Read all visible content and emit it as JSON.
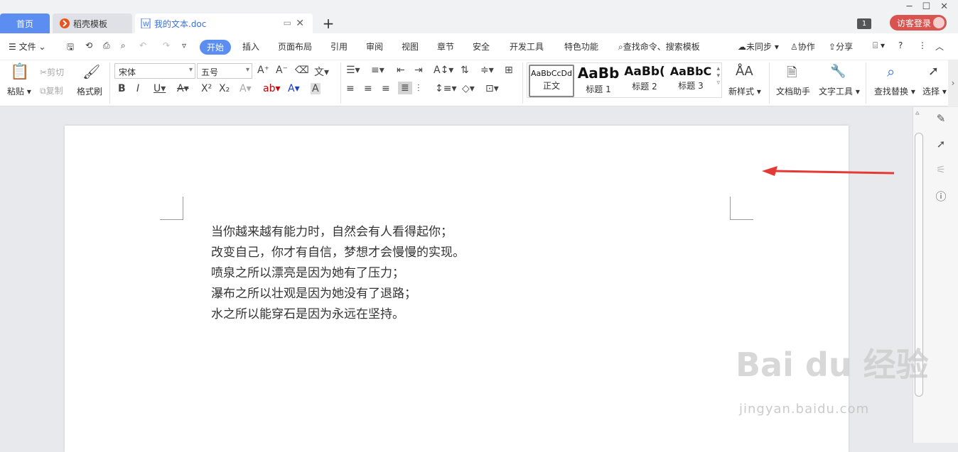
{
  "tabs": {
    "home": "首页",
    "template": "稻壳模板",
    "doc": "我的文本.doc"
  },
  "header": {
    "badge": "1",
    "login": "访客登录"
  },
  "menu": {
    "file": "文件",
    "items": [
      "开始",
      "插入",
      "页面布局",
      "引用",
      "审阅",
      "视图",
      "章节",
      "安全",
      "开发工具",
      "特色功能"
    ],
    "search": "查找命令、搜索模板",
    "sync": "未同步",
    "collab": "协作",
    "share": "分享"
  },
  "ribbon": {
    "paste": "粘贴",
    "cut": "剪切",
    "copy": "复制",
    "format_painter": "格式刷",
    "font_name": "宋体",
    "font_size": "五号",
    "styles": [
      {
        "preview": "AaBbCcDd",
        "label": "正文"
      },
      {
        "preview": "AaBb",
        "label": "标题 1"
      },
      {
        "preview": "AaBb(",
        "label": "标题 2"
      },
      {
        "preview": "AaBbC",
        "label": "标题 3"
      }
    ],
    "new_style": "新样式",
    "doc_helper": "文档助手",
    "text_tools": "文字工具",
    "find_replace": "查找替换",
    "select": "选择"
  },
  "document": {
    "lines": [
      "当你越来越有能力时，自然会有人看得起你；",
      "改变自己，你才有自信，梦想才会慢慢的实现。",
      "喷泉之所以漂亮是因为她有了压力；",
      "瀑布之所以壮观是因为她没有了退路；",
      "水之所以能穿石是因为永远在坚持。"
    ]
  },
  "watermark": {
    "brand": "Bai du 经验",
    "url": "jingyan.baidu.com"
  },
  "colors": {
    "accent": "#5b8ef0",
    "login": "#d9534f",
    "arrow": "#e53935"
  }
}
